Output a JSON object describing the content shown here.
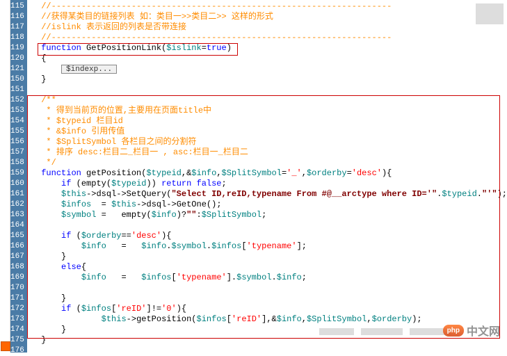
{
  "gutter": [
    "115",
    "116",
    "117",
    "118",
    "119",
    "120",
    "121",
    "150",
    "151",
    "152",
    "153",
    "154",
    "155",
    "156",
    "157",
    "158",
    "159",
    "160",
    "161",
    "162",
    "163",
    "164",
    "165",
    "166",
    "167",
    "168",
    "169",
    "170",
    "171",
    "172",
    "173",
    "174",
    "175",
    "176"
  ],
  "code": {
    "l115": "//--------------------------------------------------------------------",
    "l116_a": "//获得某类目的链接列表 如：类目一>>类目二>> 这样的形式",
    "l117": "//islink 表示返回的列表是否带连接",
    "l118": "//--------------------------------------------------------------------",
    "l119_kw": "function",
    "l119_fn": " GetPositionLink(",
    "l119_var": "$islink",
    "l119_eq": "=",
    "l119_bool": "true",
    "l119_end": ")",
    "l120": "{",
    "l121_fold": "$indexp...",
    "l150": "}",
    "l152": "/**",
    "l153": " * 得到当前页的位置,主要用在页面title中",
    "l154": " * $typeid 栏目id",
    "l155": " * &$info 引用传值",
    "l156": " * $SplitSymbol 各栏目之间的分割符",
    "l157": " * 排序 desc:栏目二_栏目一 , asc:栏目一_栏目二",
    "l158": " */",
    "l159_kw": "function",
    "l159_fn": " getPosition(",
    "l159_v1": "$typeid",
    "l159_c1": ",&",
    "l159_v2": "$info",
    "l159_c2": ",",
    "l159_v3": "$SplitSymbol",
    "l159_eq1": "=",
    "l159_s1": "'_'",
    "l159_c3": ",",
    "l159_v4": "$orderby",
    "l159_eq2": "=",
    "l159_s2": "'desc'",
    "l159_end": "){",
    "l160_kw1": "if",
    "l160_p1": " (empty(",
    "l160_v": "$typeid",
    "l160_p2": ")) ",
    "l160_kw2": "return false",
    "l160_end": ";",
    "l161_v1": "$this",
    "l161_p1": "->dsql->SetQuery(",
    "l161_s": "\"Select ID,reID,typename From #@__arctype where ID='\"",
    "l161_p2": ".",
    "l161_v2": "$typeid",
    "l161_p3": ".",
    "l161_s2": "\"'\"",
    "l161_end": ");",
    "l162_v1": "$infos",
    "l162_eq": "  = ",
    "l162_v2": "$this",
    "l162_end": "->dsql->GetOne();",
    "l163_v1": "$symbol",
    "l163_eq": " =   empty(",
    "l163_v2": "$info",
    "l163_p1": ")?",
    "l163_s": "\"\"",
    "l163_p2": ":",
    "l163_v3": "$SplitSymbol",
    "l163_end": ";",
    "l165_kw": "if",
    "l165_p1": " (",
    "l165_v": "$orderby",
    "l165_eq": "==",
    "l165_s": "'desc'",
    "l165_end": "){",
    "l166_v1": "$info",
    "l166_eq": "   =   ",
    "l166_v2": "$info",
    "l166_p1": ".",
    "l166_v3": "$symbol",
    "l166_p2": ".",
    "l166_v4": "$infos",
    "l166_p3": "[",
    "l166_s": "'typename'",
    "l166_end": "];",
    "l167": "}",
    "l168_kw": "else",
    "l168_end": "{",
    "l169_v1": "$info",
    "l169_eq": "   =   ",
    "l169_v2": "$infos",
    "l169_p1": "[",
    "l169_s": "'typename'",
    "l169_p2": "].",
    "l169_v3": "$symbol",
    "l169_p3": ".",
    "l169_v4": "$info",
    "l169_end": ";",
    "l171": "}",
    "l172_kw": "if",
    "l172_p1": " (",
    "l172_v": "$infos",
    "l172_p2": "[",
    "l172_s1": "'reID'",
    "l172_p3": "]!=",
    "l172_s2": "'0'",
    "l172_end": "){",
    "l173_v1": "$this",
    "l173_p1": "->getPosition(",
    "l173_v2": "$infos",
    "l173_p2": "[",
    "l173_s": "'reID'",
    "l173_p3": "],&",
    "l173_v3": "$info",
    "l173_c1": ",",
    "l173_v4": "$SplitSymbol",
    "l173_c2": ",",
    "l173_v5": "$orderby",
    "l173_end": ");",
    "l174": "}",
    "l175": "}"
  },
  "watermark": {
    "badge": "php",
    "text": "中文网"
  }
}
